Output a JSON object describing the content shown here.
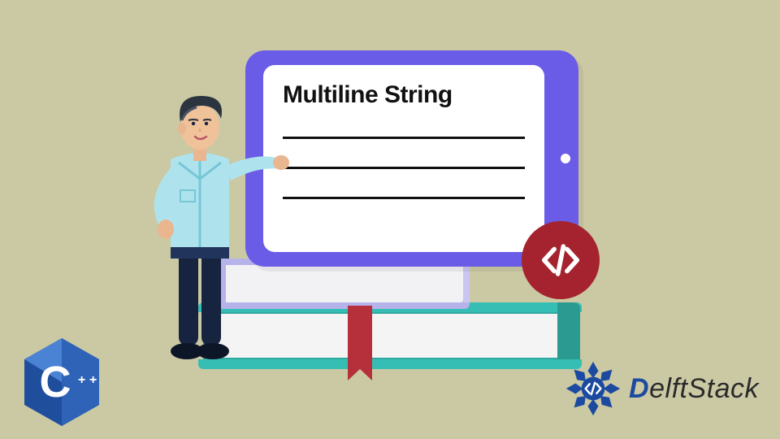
{
  "tablet": {
    "heading": "Multiline String"
  },
  "code_badge": {
    "symbol": "</>"
  },
  "cpp_logo": {
    "letter": "C",
    "plus": "++"
  },
  "brand": {
    "initial": "D",
    "rest": "elftStack"
  },
  "colors": {
    "bg": "#cbc9a4",
    "tablet_frame": "#6b5ce7",
    "badge": "#a4232e",
    "book_teal": "#2fa9a0",
    "book_lav": "#c9c6ef",
    "bookmark": "#b5303a",
    "cpp_blue_outer": "#1f4e9c",
    "cpp_blue_inner": "#3a6fc4",
    "brand_blue": "#1b4aa0"
  }
}
